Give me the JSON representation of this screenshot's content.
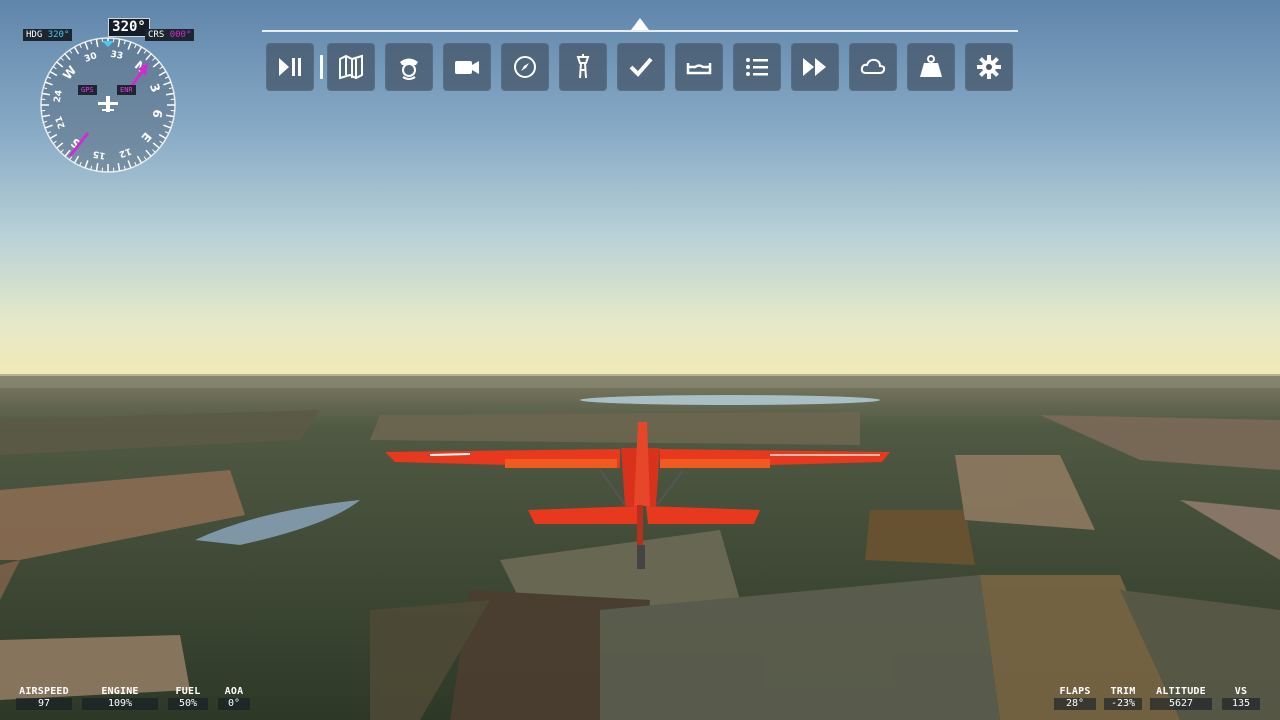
{
  "toolbar": {
    "buttons": [
      {
        "name": "pause-play",
        "icon": "play-pause-icon"
      },
      {
        "name": "map",
        "icon": "map-icon"
      },
      {
        "name": "pilot",
        "icon": "pilot-icon"
      },
      {
        "name": "camera",
        "icon": "camera-icon"
      },
      {
        "name": "navlog",
        "icon": "compass-icon"
      },
      {
        "name": "atc",
        "icon": "tower-icon"
      },
      {
        "name": "checklist",
        "icon": "checkmark-icon"
      },
      {
        "name": "controls",
        "icon": "yoke-icon"
      },
      {
        "name": "objectives",
        "icon": "list-icon"
      },
      {
        "name": "sim-rate",
        "icon": "fast-forward-icon"
      },
      {
        "name": "weather",
        "icon": "cloud-icon"
      },
      {
        "name": "weight-balance",
        "icon": "weight-icon"
      },
      {
        "name": "settings",
        "icon": "gear-icon"
      }
    ]
  },
  "compass": {
    "heading_readout": "320°",
    "hdg_label": "HDG",
    "hdg_value": "320°",
    "crs_label": "CRS",
    "crs_value": "000°",
    "gps_tag": "GPS",
    "enr_tag": "ENR",
    "card_labels": [
      "N",
      "3",
      "6",
      "E",
      "12",
      "15",
      "S",
      "21",
      "24",
      "W",
      "30",
      "33"
    ]
  },
  "gauges_left": [
    {
      "label": "AIRSPEED",
      "value": "97"
    },
    {
      "label": "ENGINE",
      "value": "109%"
    },
    {
      "label": "FUEL",
      "value": "50%"
    },
    {
      "label": "AOA",
      "value": "0°"
    }
  ],
  "gauges_right": [
    {
      "label": "FLAPS",
      "value": "28°"
    },
    {
      "label": "TRIM",
      "value": "-23%"
    },
    {
      "label": "ALTITUDE",
      "value": "5627"
    },
    {
      "label": "VS",
      "value": "135"
    }
  ],
  "colors": {
    "heading_cyan": "#49c8f0",
    "course_magenta": "#d22bd2",
    "aircraft_red": "#e8381e",
    "toolbar_bg": "#46586c"
  }
}
